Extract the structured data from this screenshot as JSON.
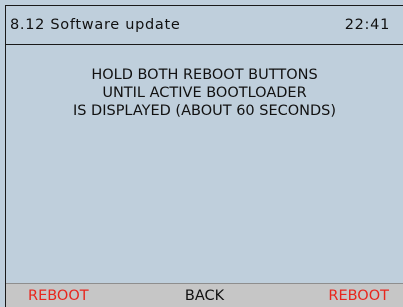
{
  "header": {
    "title": "8.12 Software update",
    "time": "22:41"
  },
  "message": {
    "lines": [
      "HOLD BOTH REBOOT BUTTONS",
      "UNTIL ACTIVE BOOTLOADER",
      "IS DISPLAYED (ABOUT 60 SECONDS)"
    ]
  },
  "softkeys": {
    "left": "REBOOT",
    "center": "BACK",
    "right": "REBOOT"
  },
  "colors": {
    "screen_background": "#bfcfdc",
    "softkey_bar": "#c6c6c6",
    "reboot_text": "#e8261d",
    "text": "#111111"
  }
}
